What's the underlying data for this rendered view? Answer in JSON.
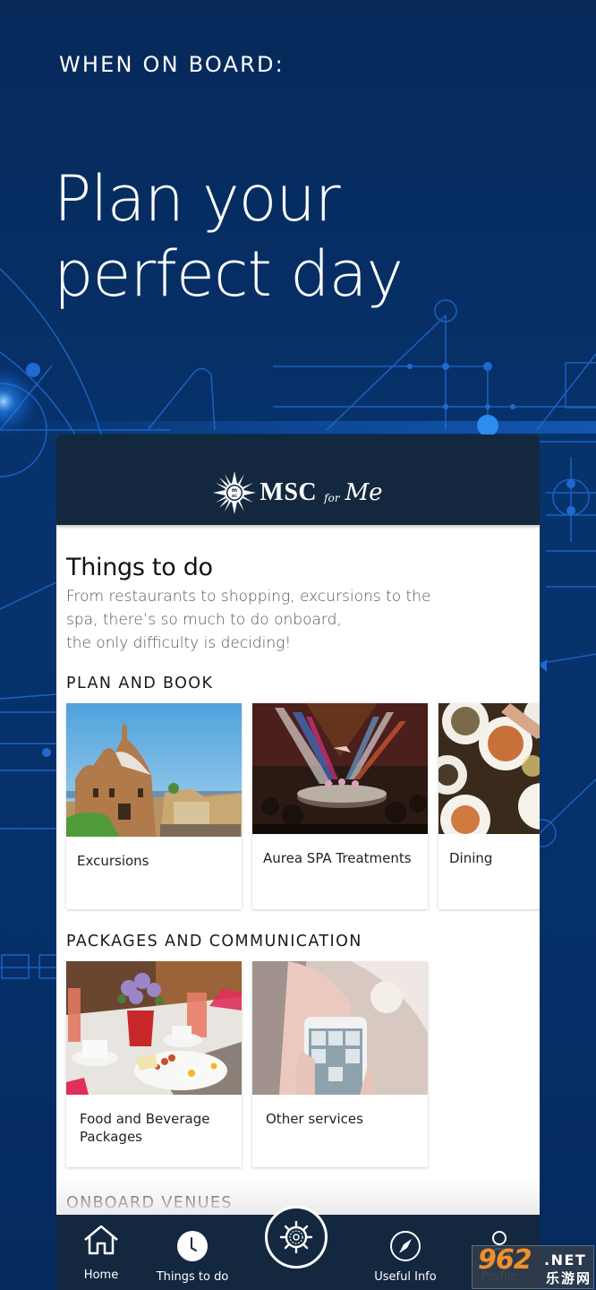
{
  "promo": {
    "eyebrow": "WHEN ON BOARD:",
    "headline_line1": "Plan your",
    "headline_line2": "perfect day"
  },
  "app": {
    "logo": {
      "brand": "MSC",
      "for": "for",
      "script": "Me",
      "emblem_text": "msc"
    },
    "page_title": "Things to do",
    "intro": {
      "line1": "From restaurants to shopping, excursions to the",
      "line2": "spa, there’s so much to do onboard,",
      "line3": "the only difficulty is deciding!"
    },
    "sections": [
      {
        "title": "PLAN AND BOOK",
        "cards": [
          {
            "label": "Excursions",
            "image": "park-guell-building"
          },
          {
            "label": "Aurea SPA Treatments",
            "image": "circus-show-stage"
          },
          {
            "label": "Dining",
            "image": "table-with-dishes"
          }
        ]
      },
      {
        "title": "PACKAGES AND COMMUNICATION",
        "cards": [
          {
            "label": "Food and Beverage Packages",
            "image": "breakfast-table"
          },
          {
            "label": "Other services",
            "image": "hand-holding-phone"
          }
        ]
      },
      {
        "title": "ONBOARD VENUES",
        "cards": []
      }
    ],
    "bottom_nav": {
      "items": [
        {
          "label": "Home",
          "icon": "home-icon"
        },
        {
          "label": "Things to do",
          "icon": "clock-icon"
        },
        {
          "label": "",
          "icon": "ship-wheel-icon"
        },
        {
          "label": "Useful Info",
          "icon": "compass-icon"
        },
        {
          "label": "Profile",
          "icon": "profile-icon"
        }
      ]
    }
  },
  "watermark": {
    "number": "962",
    "domain": ".NET",
    "chinese": "乐游网"
  },
  "colors": {
    "background": "#07336d",
    "header": "#13283f",
    "accent_lines": "#1e6fd9"
  }
}
